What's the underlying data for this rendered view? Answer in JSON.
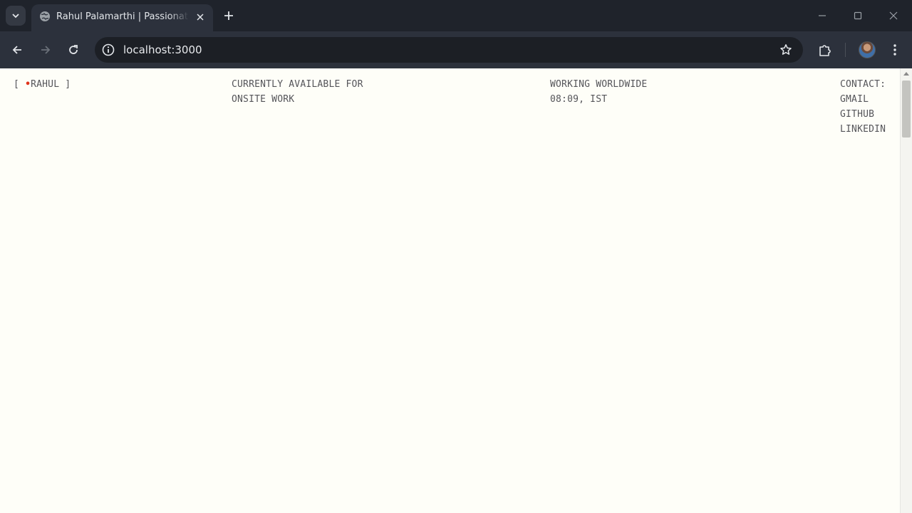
{
  "browser": {
    "tab": {
      "title": "Rahul Palamarthi | Passionate product developer"
    },
    "address_bar": {
      "url": "localhost:3000"
    },
    "icons": {
      "tab_search": "chevron-down-icon",
      "favicon": "globe-icon",
      "tab_close": "close-icon",
      "new_tab": "plus-icon",
      "minimize": "minimize-icon",
      "maximize": "maximize-icon",
      "close_window": "close-icon",
      "back": "arrow-left-icon",
      "forward": "arrow-right-icon",
      "reload": "reload-icon",
      "site_info": "info-icon",
      "bookmark": "star-icon",
      "extensions": "puzzle-icon",
      "menu": "kebab-menu-icon"
    }
  },
  "page": {
    "brand": {
      "open_bracket": "[",
      "dot": "•",
      "name": "RAHUL",
      "close_bracket": "]"
    },
    "availability": {
      "line1": "CURRENTLY AVAILABLE FOR",
      "line2": "ONSITE WORK"
    },
    "location": {
      "line1": "WORKING WORLDWIDE",
      "time": "08:09, IST"
    },
    "contact": {
      "label": "CONTACT:",
      "links": [
        "GMAIL",
        "GITHUB",
        "LINKEDIN"
      ]
    },
    "colors": {
      "background": "#fefef8",
      "text": "#55555a",
      "accent_dot": "#e0341c"
    }
  }
}
